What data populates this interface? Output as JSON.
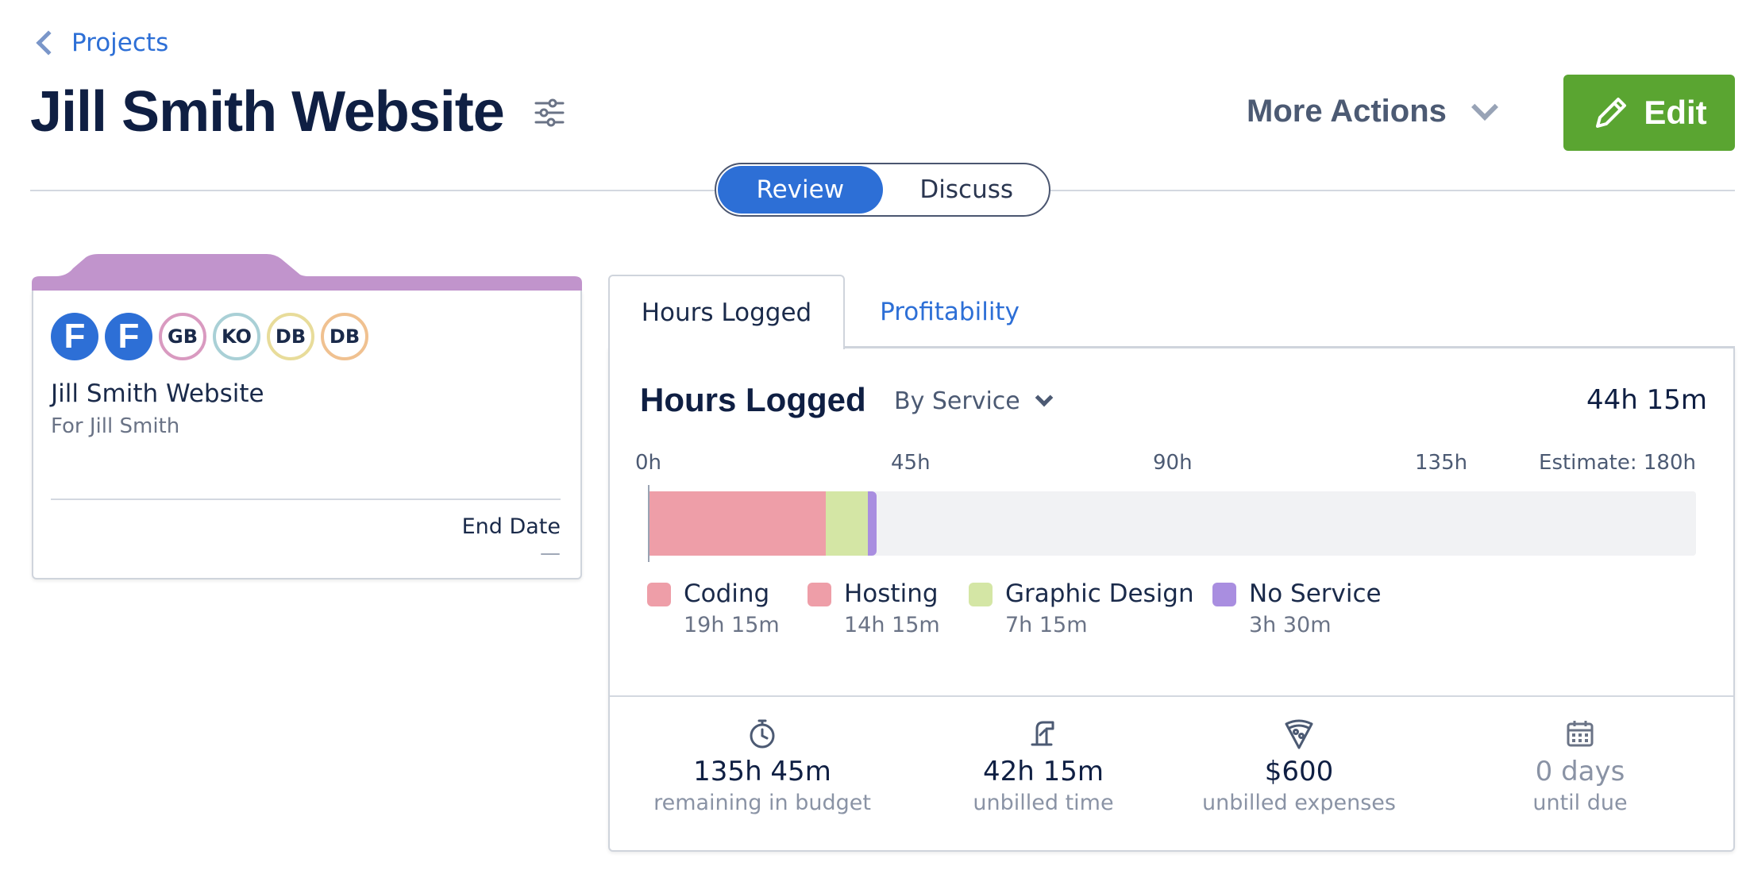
{
  "nav": {
    "back_label": "Projects"
  },
  "header": {
    "title": "Jill Smith Website",
    "more_actions_label": "More Actions",
    "edit_label": "Edit"
  },
  "view_toggle": {
    "options": [
      "Review",
      "Discuss"
    ],
    "selected": "Review"
  },
  "project_card": {
    "avatars": [
      {
        "text": "F",
        "style": "logo",
        "color": "#2d6fd6"
      },
      {
        "text": "F",
        "style": "logo",
        "color": "#2d6fd6"
      },
      {
        "text": "GB",
        "style": "ring",
        "color": "#d99ac0"
      },
      {
        "text": "KO",
        "style": "ring",
        "color": "#a9d0d6"
      },
      {
        "text": "DB",
        "style": "ring",
        "color": "#e8dc9a"
      },
      {
        "text": "DB",
        "style": "ring",
        "color": "#f0c190"
      }
    ],
    "name": "Jill Smith Website",
    "client": "For Jill Smith",
    "end_date_label": "End Date",
    "end_date_value": "—",
    "tab_color": "#c194cc"
  },
  "tabs": {
    "hours_logged": "Hours Logged",
    "profitability": "Profitability"
  },
  "hours_panel": {
    "title": "Hours Logged",
    "group_by": "By Service",
    "total": "44h 15m"
  },
  "chart_data": {
    "type": "bar",
    "orientation": "horizontal-stacked",
    "x_ticks": [
      "0h",
      "45h",
      "90h",
      "135h"
    ],
    "estimate_label": "Estimate: 180h",
    "xlim": [
      0,
      180
    ],
    "series": [
      {
        "name": "Coding",
        "label": "19h 15m",
        "value": 19.25,
        "color": "#ee9ea8"
      },
      {
        "name": "Hosting",
        "label": "14h 15m",
        "value": 14.25,
        "color": "#ee9ea8"
      },
      {
        "name": "Graphic Design",
        "label": "7h 15m",
        "value": 7.25,
        "color": "#d4e6a5"
      },
      {
        "name": "No Service",
        "label": "3h 30m",
        "value": 3.5,
        "color": "#a98ee0"
      }
    ],
    "bar_segments": [
      {
        "value": 30.5,
        "color": "#ee9ea8"
      },
      {
        "value": 7.25,
        "color": "#d4e6a5"
      },
      {
        "value": 1.5,
        "color": "#a98ee0"
      }
    ]
  },
  "stats": [
    {
      "value": "135h 45m",
      "label": "remaining in budget",
      "icon": "stopwatch-icon",
      "muted": false
    },
    {
      "value": "42h 15m",
      "label": "unbilled time",
      "icon": "quill-icon",
      "muted": false
    },
    {
      "value": "$600",
      "label": "unbilled expenses",
      "icon": "pizza-icon",
      "muted": false
    },
    {
      "value": "0 days",
      "label": "until due",
      "icon": "calendar-icon",
      "muted": true
    }
  ]
}
